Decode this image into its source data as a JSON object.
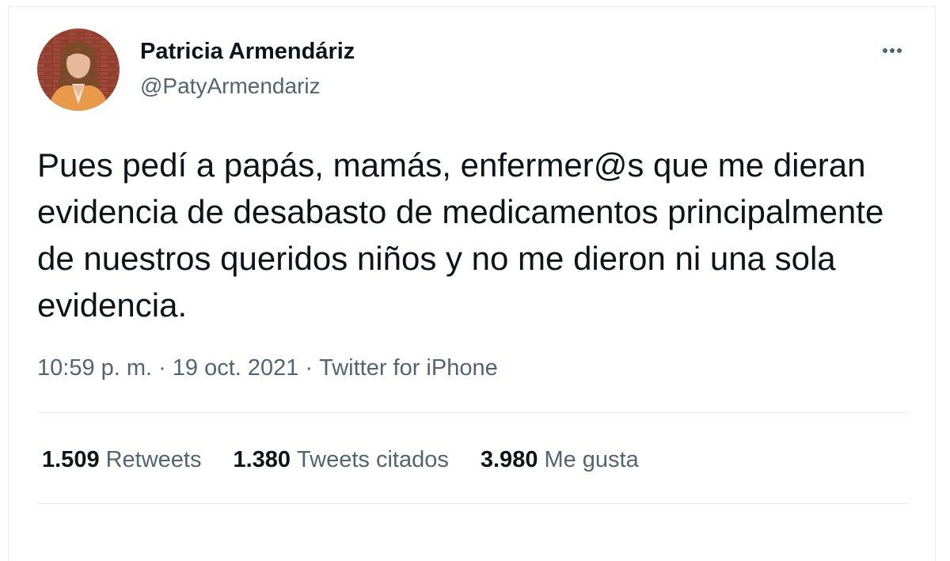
{
  "author": {
    "name": "Patricia Armendáriz",
    "handle": "@PatyArmendariz"
  },
  "menu_icon": "more-horizontal-icon",
  "tweet": {
    "text": "Pues pedí a papás, mamás, enfermer@s que me dieran evidencia de desabasto de medicamentos principalmente de nuestros queridos niños y no me dieron ni una sola evidencia."
  },
  "meta": {
    "time": "10:59 p. m.",
    "separator": "·",
    "date": "19 oct. 2021",
    "source": "Twitter for iPhone"
  },
  "stats": [
    {
      "count": "1.509",
      "label": "Retweets"
    },
    {
      "count": "1.380",
      "label": "Tweets citados"
    },
    {
      "count": "3.980",
      "label": "Me gusta"
    }
  ],
  "colors": {
    "text_primary": "#0f1419",
    "text_secondary": "#536471",
    "divider": "#e6ecf0"
  }
}
